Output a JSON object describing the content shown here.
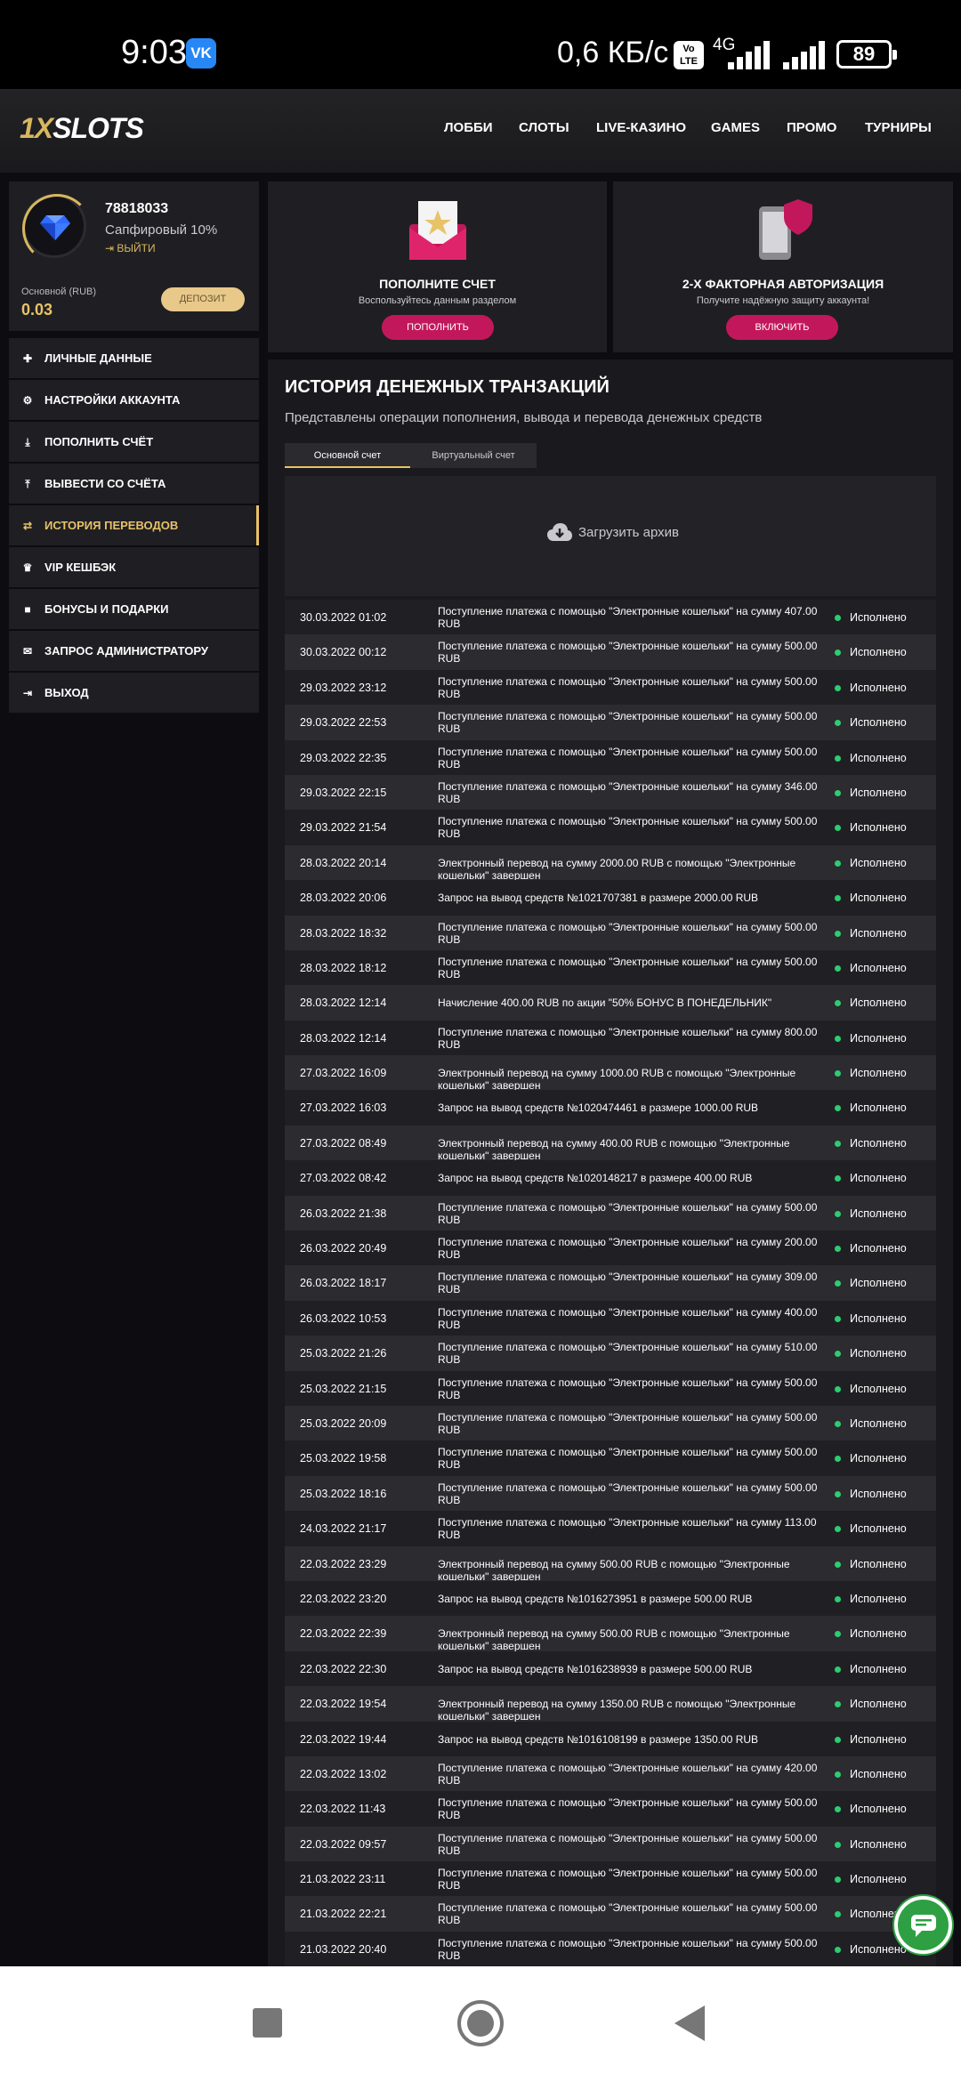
{
  "status_bar": {
    "time": "9:03",
    "vk_icon": "VK",
    "speed": "0,6 КБ/с",
    "volte": "Vo LTE",
    "network": "4G",
    "battery": "89"
  },
  "header": {
    "logo_prefix": "1X",
    "logo_suffix": "SLOTS",
    "nav": [
      "ЛОББИ",
      "СЛОТЫ",
      "LIVE-КАЗИНО",
      "GAMES",
      "ПРОМО",
      "ТУРНИРЫ"
    ]
  },
  "profile": {
    "id": "78818033",
    "level": "Сапфировый 10%",
    "exit": "ВЫЙТИ",
    "account_label": "Основной (RUB)",
    "balance": "0.03",
    "deposit_button": "ДЕПОЗИТ"
  },
  "menu": [
    {
      "label": "ЛИЧНЫЕ ДАННЫЕ",
      "icon": "user-plus-icon",
      "glyph": "👤"
    },
    {
      "label": "НАСТРОЙКИ АККАУНТА",
      "icon": "gears-icon",
      "glyph": "⚙"
    },
    {
      "label": "ПОПОЛНИТЬ СЧЁТ",
      "icon": "download-icon",
      "glyph": "⤓"
    },
    {
      "label": "ВЫВЕСТИ СО СЧЁТА",
      "icon": "upload-icon",
      "glyph": "⤒"
    },
    {
      "label": "ИСТОРИЯ ПЕРЕВОДОВ",
      "icon": "transfer-arrows-icon",
      "glyph": "⇄"
    },
    {
      "label": "VIP КЕШБЭК",
      "icon": "crown-icon",
      "glyph": "♛"
    },
    {
      "label": "БОНУСЫ И ПОДАРКИ",
      "icon": "gift-icon",
      "glyph": "🎁"
    },
    {
      "label": "ЗАПРОС АДМИНИСТРАТОРУ",
      "icon": "envelope-icon",
      "glyph": "✉"
    },
    {
      "label": "ВЫХОД",
      "icon": "sign-out-icon",
      "glyph": "⇥"
    }
  ],
  "cards": {
    "deposit": {
      "title": "ПОПОЛНИТЕ СЧЕТ",
      "subtitle": "Воспользуйтесь данным разделом",
      "button": "ПОПОЛНИТЬ"
    },
    "twofa": {
      "title": "2-Х ФАКТОРНАЯ АВТОРИЗАЦИЯ",
      "subtitle": "Получите надёжную защиту аккаунта!",
      "button": "ВКЛЮЧИТЬ"
    }
  },
  "history": {
    "title": "ИСТОРИЯ ДЕНЕЖНЫХ ТРАНЗАКЦИЙ",
    "subtitle": "Представлены операции пополнения, вывода и перевода денежных средств",
    "tabs": [
      "Основной счет",
      "Виртуальный счет"
    ],
    "archive": "Загрузить архив",
    "transactions": [
      {
        "date": "30.03.2022 01:02",
        "desc": "Поступление платежа с помощью \"Электронные кошельки\" на сумму 407.00 RUB",
        "status": "Исполнено"
      },
      {
        "date": "30.03.2022 00:12",
        "desc": "Поступление платежа с помощью \"Электронные кошельки\" на сумму 500.00 RUB",
        "status": "Исполнено"
      },
      {
        "date": "29.03.2022 23:12",
        "desc": "Поступление платежа с помощью \"Электронные кошельки\" на сумму 500.00 RUB",
        "status": "Исполнено"
      },
      {
        "date": "29.03.2022 22:53",
        "desc": "Поступление платежа с помощью \"Электронные кошельки\" на сумму 500.00 RUB",
        "status": "Исполнено"
      },
      {
        "date": "29.03.2022 22:35",
        "desc": "Поступление платежа с помощью \"Электронные кошельки\" на сумму 500.00 RUB",
        "status": "Исполнено"
      },
      {
        "date": "29.03.2022 22:15",
        "desc": "Поступление платежа с помощью \"Электронные кошельки\" на сумму 346.00 RUB",
        "status": "Исполнено"
      },
      {
        "date": "29.03.2022 21:54",
        "desc": "Поступление платежа с помощью \"Электронные кошельки\" на сумму 500.00 RUB",
        "status": "Исполнено"
      },
      {
        "date": "28.03.2022 20:14",
        "desc": "Электронный перевод на сумму 2000.00 RUB с помощью \"Электронные кошельки\" завершен",
        "status": "Исполнено"
      },
      {
        "date": "28.03.2022 20:06",
        "desc": "Запрос на вывод средств №1021707381 в размере 2000.00 RUB",
        "status": "Исполнено"
      },
      {
        "date": "28.03.2022 18:32",
        "desc": "Поступление платежа с помощью \"Электронные кошельки\" на сумму 500.00 RUB",
        "status": "Исполнено"
      },
      {
        "date": "28.03.2022 18:12",
        "desc": "Поступление платежа с помощью \"Электронные кошельки\" на сумму 500.00 RUB",
        "status": "Исполнено"
      },
      {
        "date": "28.03.2022 12:14",
        "desc": "Начисление 400.00 RUB по акции \"50% БОНУС В ПОНЕДЕЛЬНИК\"",
        "status": "Исполнено"
      },
      {
        "date": "28.03.2022 12:14",
        "desc": "Поступление платежа с помощью \"Электронные кошельки\" на сумму 800.00 RUB",
        "status": "Исполнено"
      },
      {
        "date": "27.03.2022 16:09",
        "desc": "Электронный перевод на сумму 1000.00 RUB с помощью \"Электронные кошельки\" завершен",
        "status": "Исполнено"
      },
      {
        "date": "27.03.2022 16:03",
        "desc": "Запрос на вывод средств №1020474461 в размере 1000.00 RUB",
        "status": "Исполнено"
      },
      {
        "date": "27.03.2022 08:49",
        "desc": "Электронный перевод на сумму 400.00 RUB с помощью \"Электронные кошельки\" завершен",
        "status": "Исполнено"
      },
      {
        "date": "27.03.2022 08:42",
        "desc": "Запрос на вывод средств №1020148217 в размере 400.00 RUB",
        "status": "Исполнено"
      },
      {
        "date": "26.03.2022 21:38",
        "desc": "Поступление платежа с помощью \"Электронные кошельки\" на сумму 500.00 RUB",
        "status": "Исполнено"
      },
      {
        "date": "26.03.2022 20:49",
        "desc": "Поступление платежа с помощью \"Электронные кошельки\" на сумму 200.00 RUB",
        "status": "Исполнено"
      },
      {
        "date": "26.03.2022 18:17",
        "desc": "Поступление платежа с помощью \"Электронные кошельки\" на сумму 309.00 RUB",
        "status": "Исполнено"
      },
      {
        "date": "26.03.2022 10:53",
        "desc": "Поступление платежа с помощью \"Электронные кошельки\" на сумму 400.00 RUB",
        "status": "Исполнено"
      },
      {
        "date": "25.03.2022 21:26",
        "desc": "Поступление платежа с помощью \"Электронные кошельки\" на сумму 510.00 RUB",
        "status": "Исполнено"
      },
      {
        "date": "25.03.2022 21:15",
        "desc": "Поступление платежа с помощью \"Электронные кошельки\" на сумму 500.00 RUB",
        "status": "Исполнено"
      },
      {
        "date": "25.03.2022 20:09",
        "desc": "Поступление платежа с помощью \"Электронные кошельки\" на сумму 500.00 RUB",
        "status": "Исполнено"
      },
      {
        "date": "25.03.2022 19:58",
        "desc": "Поступление платежа с помощью \"Электронные кошельки\" на сумму 500.00 RUB",
        "status": "Исполнено"
      },
      {
        "date": "25.03.2022 18:16",
        "desc": "Поступление платежа с помощью \"Электронные кошельки\" на сумму 500.00 RUB",
        "status": "Исполнено"
      },
      {
        "date": "24.03.2022 21:17",
        "desc": "Поступление платежа с помощью \"Электронные кошельки\" на сумму 113.00 RUB",
        "status": "Исполнено"
      },
      {
        "date": "22.03.2022 23:29",
        "desc": "Электронный перевод на сумму 500.00 RUB с помощью \"Электронные кошельки\" завершен",
        "status": "Исполнено"
      },
      {
        "date": "22.03.2022 23:20",
        "desc": "Запрос на вывод средств №1016273951 в размере 500.00 RUB",
        "status": "Исполнено"
      },
      {
        "date": "22.03.2022 22:39",
        "desc": "Электронный перевод на сумму 500.00 RUB с помощью \"Электронные кошельки\" завершен",
        "status": "Исполнено"
      },
      {
        "date": "22.03.2022 22:30",
        "desc": "Запрос на вывод средств №1016238939 в размере 500.00 RUB",
        "status": "Исполнено"
      },
      {
        "date": "22.03.2022 19:54",
        "desc": "Электронный перевод на сумму 1350.00 RUB с помощью \"Электронные кошельки\" завершен",
        "status": "Исполнено"
      },
      {
        "date": "22.03.2022 19:44",
        "desc": "Запрос на вывод средств №1016108199 в размере 1350.00 RUB",
        "status": "Исполнено"
      },
      {
        "date": "22.03.2022 13:02",
        "desc": "Поступление платежа с помощью \"Электронные кошельки\" на сумму 420.00 RUB",
        "status": "Исполнено"
      },
      {
        "date": "22.03.2022 11:43",
        "desc": "Поступление платежа с помощью \"Электронные кошельки\" на сумму 500.00 RUB",
        "status": "Исполнено"
      },
      {
        "date": "22.03.2022 09:57",
        "desc": "Поступление платежа с помощью \"Электронные кошельки\" на сумму 500.00 RUB",
        "status": "Исполнено"
      },
      {
        "date": "21.03.2022 23:11",
        "desc": "Поступление платежа с помощью \"Электронные кошельки\" на сумму 500.00 RUB",
        "status": "Исполнено"
      },
      {
        "date": "21.03.2022 22:21",
        "desc": "Поступление платежа с помощью \"Электронные кошельки\" на сумму 500.00 RUB",
        "status": "Исполнено"
      },
      {
        "date": "21.03.2022 20:40",
        "desc": "Поступление платежа с помощью \"Электронные кошельки\" на сумму 500.00 RUB",
        "status": "Исполнено"
      }
    ]
  },
  "colors": {
    "accent_gold": "#e8c267",
    "button_pink": "#c2185b",
    "status_green": "#2ecc71",
    "panel": "#1f1f23"
  }
}
